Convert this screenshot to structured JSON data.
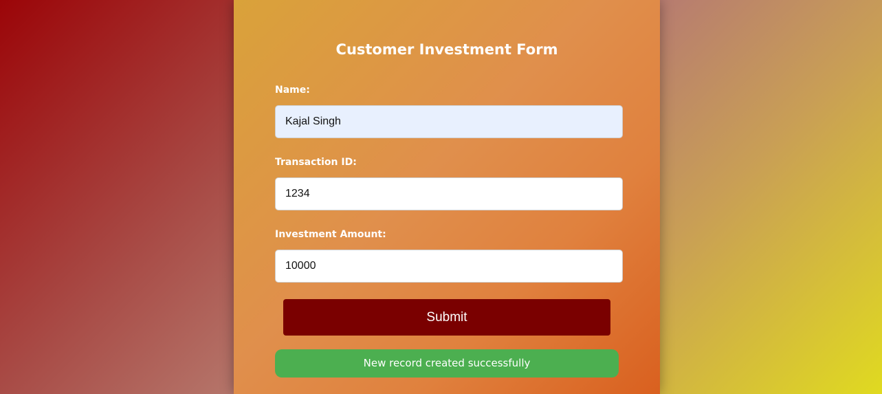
{
  "form": {
    "title": "Customer Investment Form",
    "fields": [
      {
        "label": "Name:",
        "value": "Kajal Singh"
      },
      {
        "label": "Transaction ID:",
        "value": "1234"
      },
      {
        "label": "Investment Amount:",
        "value": "10000"
      }
    ],
    "submit_label": "Submit",
    "status_message": "New record created successfully"
  },
  "colors": {
    "submit_button": "#7a0000",
    "success_message": "#4caf50",
    "autofill_field": "#e8f0fe"
  }
}
